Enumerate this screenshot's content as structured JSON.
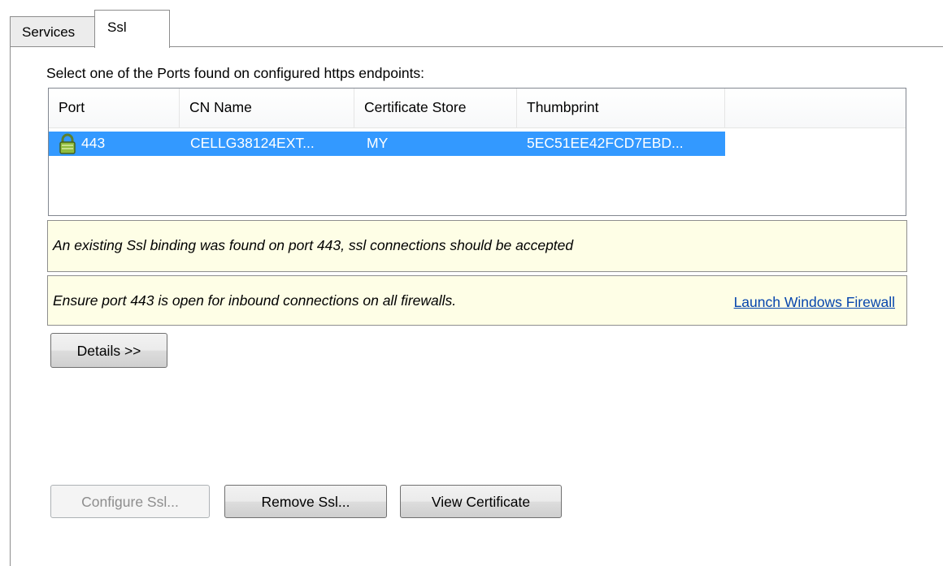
{
  "tabs": [
    {
      "label": "Services",
      "active": false
    },
    {
      "label": "Ssl",
      "active": true
    }
  ],
  "ssl": {
    "prompt": "Select one of the Ports found on configured https endpoints:",
    "columns": [
      "Port",
      "CN Name",
      "Certificate Store",
      "Thumbprint"
    ],
    "rows": [
      {
        "port": "443",
        "cn_name": "CELLG38124EXT...",
        "store": "MY",
        "thumbprint": "5EC51EE42FCD7EBD...",
        "icon": "lock-icon",
        "selected": true
      }
    ],
    "notice1": "An existing Ssl binding was found on port 443, ssl connections should be accepted",
    "notice2": "Ensure port 443 is open for inbound connections on all firewalls.",
    "firewall_link": "Launch Windows Firewall",
    "details_button": "Details >>",
    "configure_button": "Configure Ssl...",
    "remove_button": "Remove Ssl...",
    "view_cert_button": "View Certificate"
  },
  "colors": {
    "selection": "#3399ff",
    "notice_bg": "#fefee6",
    "link": "#0645ad"
  }
}
